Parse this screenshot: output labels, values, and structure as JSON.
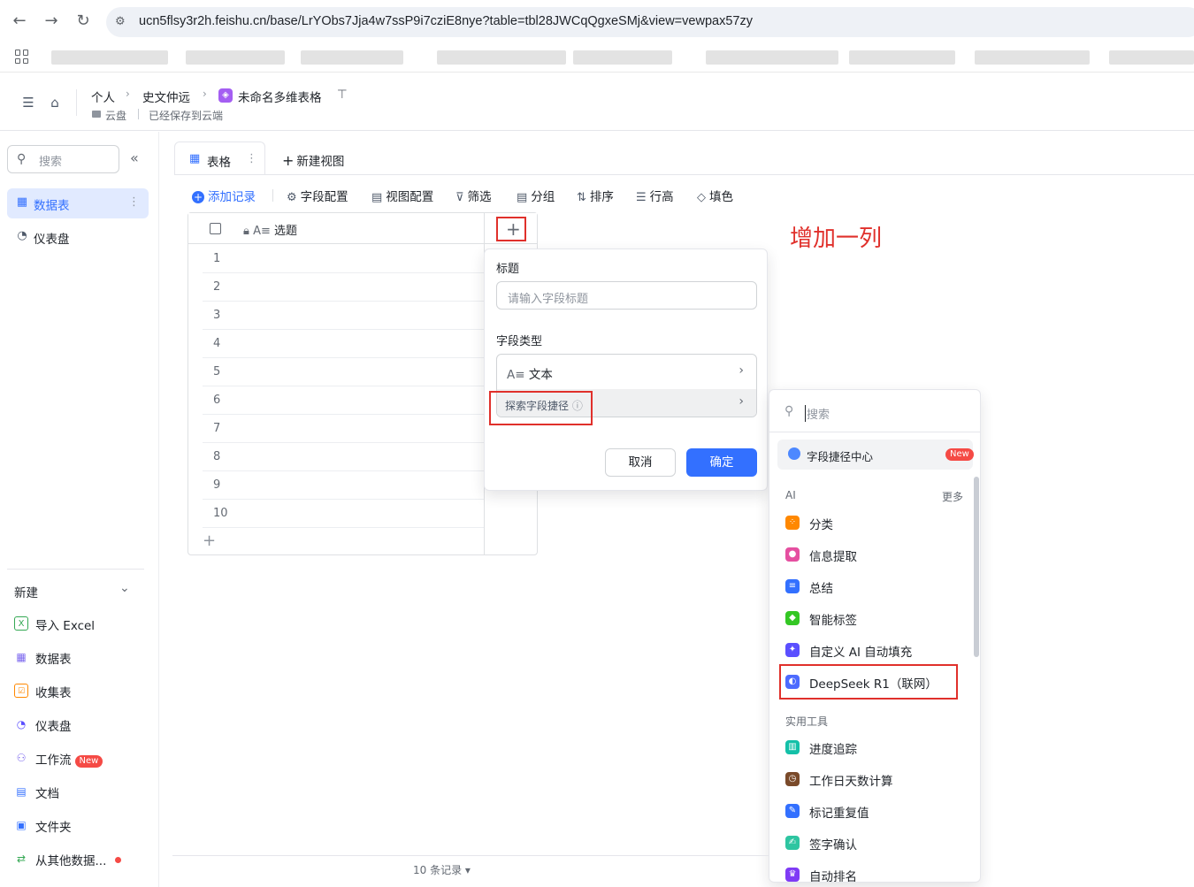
{
  "browser": {
    "url": "ucn5flsy3r2h.feishu.cn/base/LrYObs7Jja4w7ssP9i7cziE8nye?table=tbl28JWCqQgxeSMj&view=vewpax57zy"
  },
  "header": {
    "crumb_personal": "个人",
    "crumb_user": "史文仲远",
    "crumb_base": "未命名多维表格",
    "location": "云盘",
    "save_status": "已经保存到云端"
  },
  "sidebar": {
    "search_placeholder": "搜索",
    "items": [
      {
        "label": "数据表"
      },
      {
        "label": "仪表盘"
      }
    ],
    "new_header": "新建",
    "new_items": [
      {
        "label": "导入 Excel"
      },
      {
        "label": "数据表"
      },
      {
        "label": "收集表"
      },
      {
        "label": "仪表盘"
      },
      {
        "label": "工作流",
        "badge": "New"
      },
      {
        "label": "文档"
      },
      {
        "label": "文件夹"
      },
      {
        "label": "从其他数据..."
      }
    ]
  },
  "view": {
    "tab_label": "表格",
    "new_view": "新建视图"
  },
  "toolbar": {
    "add_record": "添加记录",
    "field_config": "字段配置",
    "view_config": "视图配置",
    "filter": "筛选",
    "group": "分组",
    "sort": "排序",
    "row_height": "行高",
    "fill_color": "填色"
  },
  "grid": {
    "column_title": "选题",
    "rows": [
      "1",
      "2",
      "3",
      "4",
      "5",
      "6",
      "7",
      "8",
      "9",
      "10"
    ],
    "record_count": "10 条记录"
  },
  "annotation": "增加一列",
  "field_dialog": {
    "title_label": "标题",
    "title_placeholder": "请输入字段标题",
    "type_label": "字段类型",
    "type_value": "文本",
    "explore": "探索字段捷径",
    "cancel": "取消",
    "confirm": "确定"
  },
  "shortcut_menu": {
    "search_placeholder": "搜索",
    "center_label": "字段捷径中心",
    "center_badge": "New",
    "ai_section": "AI",
    "more": "更多",
    "ai_items": [
      {
        "label": "分类",
        "color": "#ff8800"
      },
      {
        "label": "信息提取",
        "color": "#e54fa0"
      },
      {
        "label": "总结",
        "color": "#3370ff"
      },
      {
        "label": "智能标签",
        "color": "#34c724"
      },
      {
        "label": "自定义 AI 自动填充",
        "color": "#5b4fff"
      },
      {
        "label": "DeepSeek R1（联网）",
        "color": "#4d6bfe"
      }
    ],
    "tools_section": "实用工具",
    "tool_items": [
      {
        "label": "进度追踪",
        "color": "#14c0a8"
      },
      {
        "label": "工作日天数计算",
        "color": "#7a4a2a"
      },
      {
        "label": "标记重复值",
        "color": "#3370ff"
      },
      {
        "label": "签字确认",
        "color": "#2ec5a1"
      },
      {
        "label": "自动排名",
        "color": "#7f3bf5"
      }
    ]
  }
}
